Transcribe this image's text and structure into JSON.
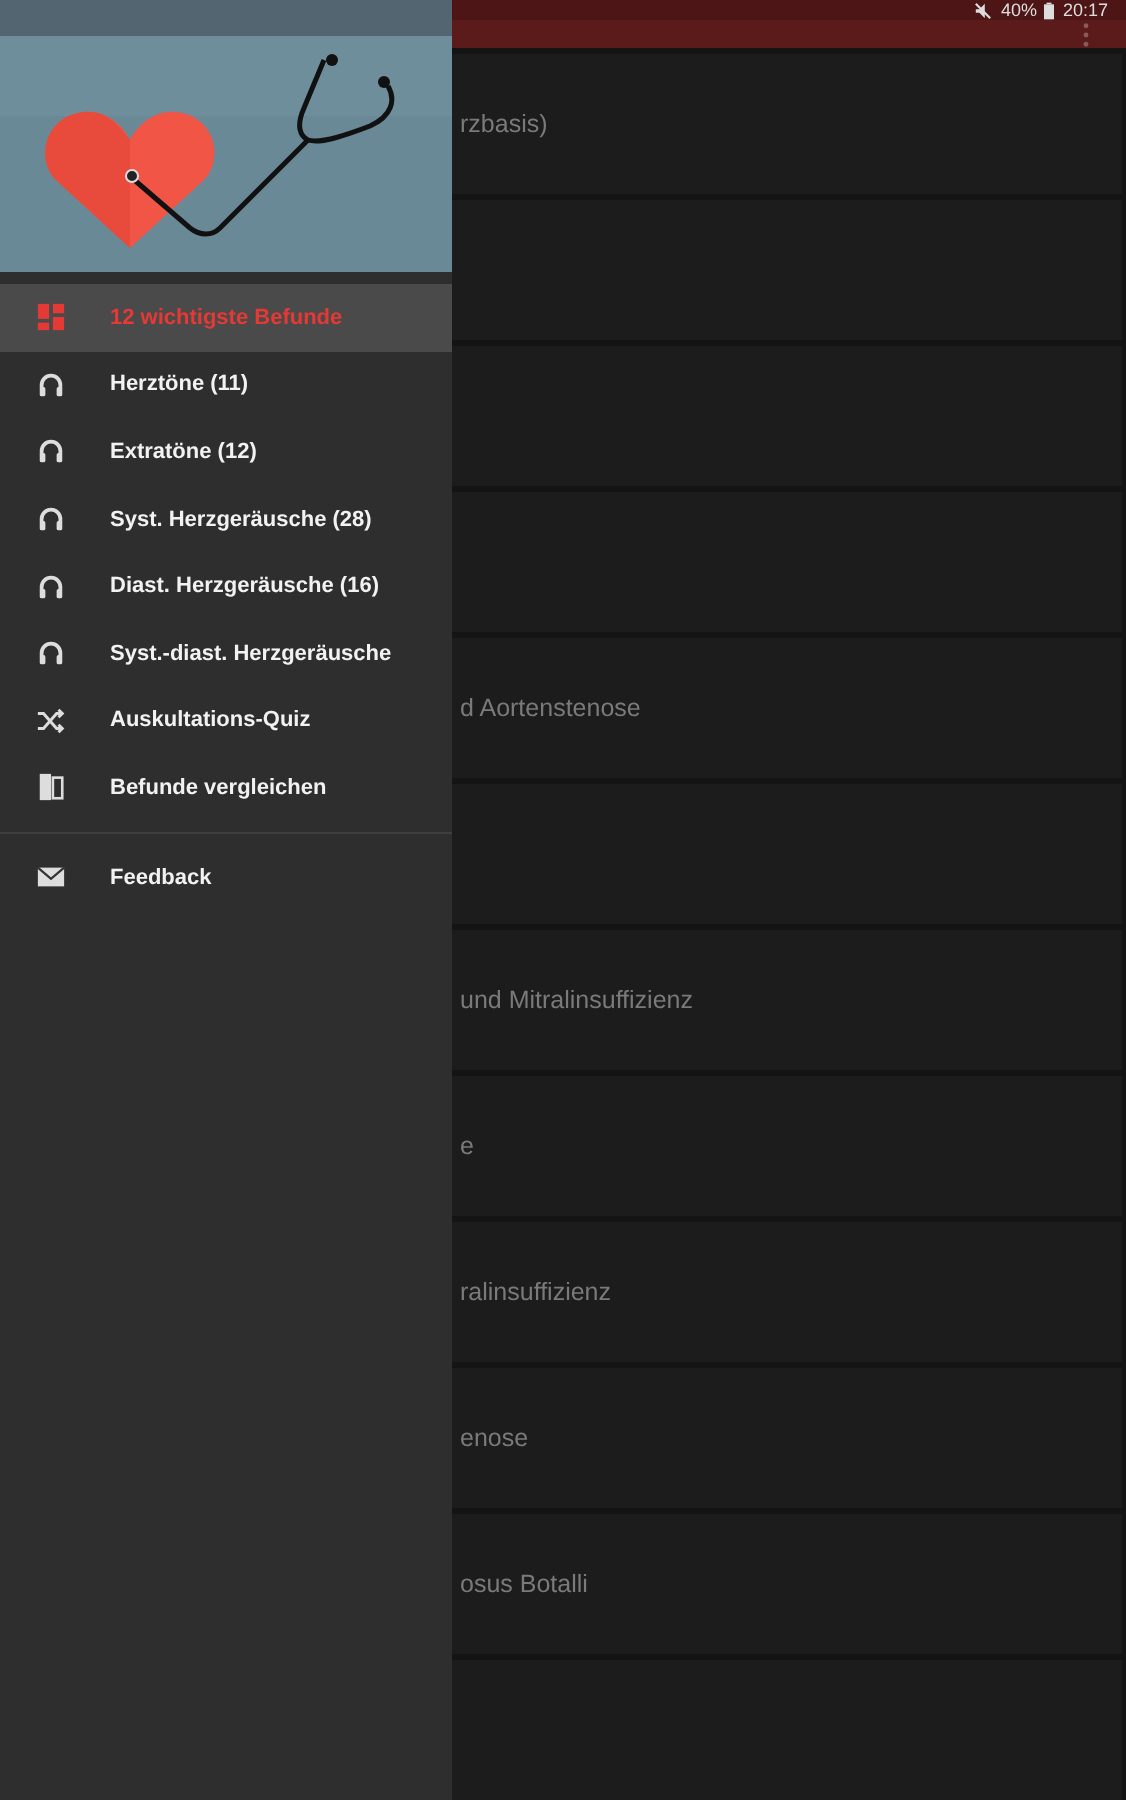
{
  "status_bar": {
    "battery": "40%",
    "time": "20:17"
  },
  "drawer": {
    "items": [
      {
        "label": "12 wichtigste Befunde",
        "kind": "grid",
        "selected": true
      },
      {
        "label": "Herztöne (11)",
        "kind": "headphones",
        "selected": false
      },
      {
        "label": "Extratöne (12)",
        "kind": "headphones",
        "selected": false
      },
      {
        "label": "Syst. Herzgeräusche (28)",
        "kind": "headphones",
        "selected": false
      },
      {
        "label": "Diast. Herzgeräusche (16)",
        "kind": "headphones",
        "selected": false
      },
      {
        "label": "Syst.-diast. Herzgeräusche",
        "kind": "headphones",
        "selected": false
      },
      {
        "label": "Auskultations-Quiz",
        "kind": "shuffle",
        "selected": false
      },
      {
        "label": "Befunde vergleichen",
        "kind": "compare",
        "selected": false
      }
    ],
    "footer_items": [
      {
        "label": "Feedback",
        "kind": "mail",
        "selected": false
      }
    ]
  },
  "list": {
    "rows": [
      {
        "title": "rzbasis)"
      },
      {},
      {},
      {},
      {
        "title": "d Aortenstenose"
      },
      {},
      {
        "title": "und Mitralinsuffizienz"
      },
      {
        "title": "e"
      },
      {
        "title": "ralinsuffizienz"
      },
      {
        "title": "enose"
      },
      {
        "title": "osus Botalli"
      },
      {}
    ]
  }
}
